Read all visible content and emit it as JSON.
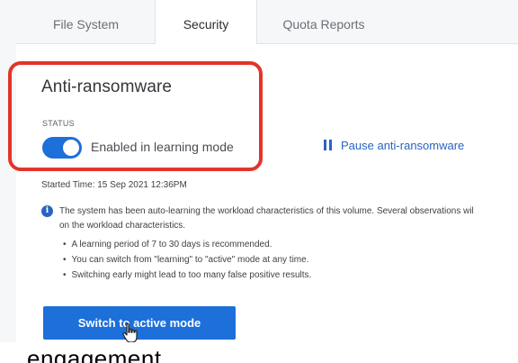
{
  "tabs": [
    {
      "label": "File System",
      "active": false
    },
    {
      "label": "Security",
      "active": true
    },
    {
      "label": "Quota Reports",
      "active": false
    }
  ],
  "section": {
    "title": "Anti-ransomware",
    "status_label": "STATUS",
    "toggle_on": true,
    "toggle_text": "Enabled in learning mode",
    "pause_link": "Pause anti-ransomware",
    "started_time": "Started Time: 15 Sep 2021 12:36PM"
  },
  "info": {
    "line1": "The system has been auto-learning the workload characteristics of this volume. Several observations wil",
    "line2": "on the workload characteristics.",
    "bullets": [
      "A learning period of 7 to 30 days is recommended.",
      "You can switch from \"learning\" to \"active\" mode at any time.",
      "Switching early might lead to too many false positive results."
    ]
  },
  "action_button": "Switch to active mode",
  "caption": "engagement.",
  "colors": {
    "accent": "#1d6fd9",
    "link": "#2a64c0",
    "highlight": "#e4342a"
  }
}
